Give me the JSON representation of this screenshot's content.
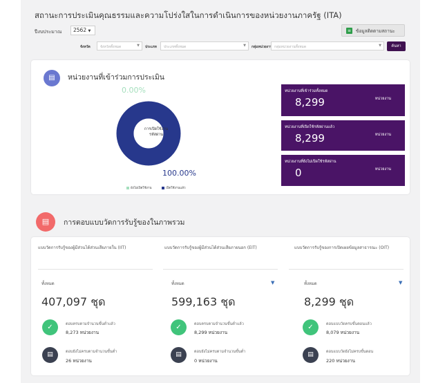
{
  "header": {
    "title": "สถานะการประเมินคุณธรรมและความโปร่งใสในการดำเนินการของหน่วยงานภาครัฐ (ITA)",
    "year_label": "ปีงบประมาณ",
    "year_value": "2562",
    "status_button": "ข้อมูลติดตามสถานะ"
  },
  "filters": {
    "province_label": "จังหวัด",
    "province_placeholder": "จังหวัดทั้งหมด",
    "type_label": "ประเภท",
    "type_placeholder": "ประเภททั้งหมด",
    "group_label": "กลุ่มหน่วยงาน",
    "group_placeholder": "กลุ่มหน่วยงานทั้งหมด",
    "search_button": "ค้นหา"
  },
  "participation": {
    "title": "หน่วยงานที่เข้าร่วมการประเมิน",
    "donut_center_line1": "การเปิดใช้งาน",
    "donut_center_line2": "รหัสผ่าน",
    "pct_top": "0.00%",
    "pct_bottom": "100.00%",
    "legend_not_opened": "ยังไม่เปิดใช้งาน",
    "legend_opened": "เปิดใช้งานแล้ว",
    "color_opened": "#27388c",
    "color_not_opened": "#a5dfbd",
    "chart_data": {
      "type": "pie",
      "categories": [
        "ยังไม่เปิดใช้งาน",
        "เปิดใช้งานแล้ว"
      ],
      "values": [
        0.0,
        100.0
      ]
    },
    "boxes": [
      {
        "label": "หน่วยงานที่เข้าร่วมทั้งหมด",
        "value": "8,299",
        "unit": "หน่วยงาน"
      },
      {
        "label": "หน่วยงานที่เปิดใช้รหัสผ่านแล้ว",
        "value": "8,299",
        "unit": "หน่วยงาน"
      },
      {
        "label": "หน่วยงานที่ยังไม่เปิดใช้รหัสผ่าน",
        "value": "0",
        "unit": "หน่วยงาน"
      }
    ]
  },
  "survey": {
    "title": "การตอบแบบวัดการรับรู้ของในภาพรวม",
    "columns": [
      {
        "heading": "แบบวัดการรับรู้ของผู้มีส่วนได้ส่วนเสียภายใน (IIT)",
        "all_label": "ทั้งหมด",
        "total": "407,097 ชุด",
        "stat1_label": "ตอบครบตามจำนวนขั้นต่ำแล้ว",
        "stat1_value": "8,273 หน่วยงาน",
        "stat2_label": "ตอบยังไม่ครบตามจำนวนขั้นต่ำ",
        "stat2_value": "26 หน่วยงาน"
      },
      {
        "heading": "แบบวัดการรับรู้ของผู้มีส่วนได้ส่วนเสียภายนอก (EIT)",
        "all_label": "ทั้งหมด",
        "total": "599,163 ชุด",
        "stat1_label": "ตอบครบตามจำนวนขั้นต่ำแล้ว",
        "stat1_value": "8,299 หน่วยงาน",
        "stat2_label": "ตอบยังไม่ครบตามจำนวนขั้นต่ำ",
        "stat2_value": "0 หน่วยงาน"
      },
      {
        "heading": "แบบวัดการรับรู้ของการเปิดเผยข้อมูลสาธารณะ (OIT)",
        "all_label": "ทั้งหมด",
        "total": "8,299 ชุด",
        "stat1_label": "ตอบแบบวัดครบขั้นตอนแล้ว",
        "stat1_value": "8,079 หน่วยงาน",
        "stat2_label": "ตอบแบบวัดยังไม่ครบขั้นตอน",
        "stat2_value": "220 หน่วยงาน"
      }
    ]
  }
}
